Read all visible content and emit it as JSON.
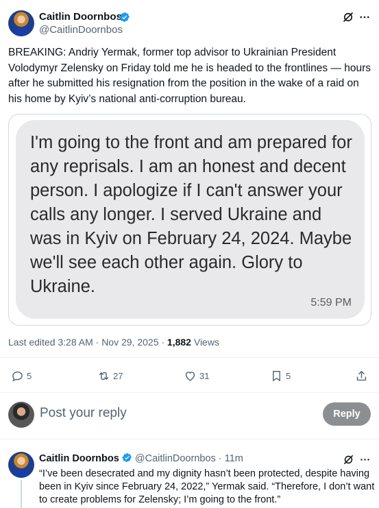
{
  "tweet": {
    "author_name": "Caitlin Doornbos",
    "author_handle": "@CaitlinDoornbos",
    "text": "BREAKING: Andriy Yermak, former top advisor to Ukrainian President Volodymyr Zelensky on Friday told me he is headed to the frontlines — hours after he submitted his resignation from the position in the wake of a raid on his home by Kyiv’s national anti-corruption bureau.",
    "media": {
      "message_text": "I'm going to the front and am prepared for any reprisals. I am an honest and decent person. I apologize if I can't answer your calls any longer. I served Ukraine and was in Kyiv on February 24, 2024. Maybe we'll see each other again. Glory to Ukraine.",
      "message_time": "5:59 PM"
    },
    "meta": {
      "edited": "Last edited 3:28 AM · Nov 29, 2025 · ",
      "views_count": "1,882",
      "views_label": " Views"
    },
    "actions": {
      "replies": "5",
      "reposts": "27",
      "likes": "31",
      "bookmarks": "5"
    }
  },
  "composer": {
    "placeholder": "Post your reply",
    "button_label": "Reply"
  },
  "reply": {
    "author_name": "Caitlin Doornbos",
    "author_handle": "@CaitlinDoornbos",
    "time": " · 11m",
    "text": "“I’ve been desecrated and my dignity hasn’t been protected, despite having been in Kyiv since February 24, 2022,” Yermak said. “Therefore, I don’t want to create problems for Zelensky; I’m going to the front.”"
  },
  "icons": {
    "verified": "verified-badge-icon",
    "grok": "grok-icon",
    "more": "more-icon",
    "reply": "reply-icon",
    "repost": "repost-icon",
    "like": "like-icon",
    "bookmark": "bookmark-icon",
    "share": "share-icon"
  },
  "colors": {
    "verified": "#1d9bf0",
    "secondary_text": "#536471",
    "reply_button": "#8c8f92",
    "bubble": "#e9e9eb"
  }
}
